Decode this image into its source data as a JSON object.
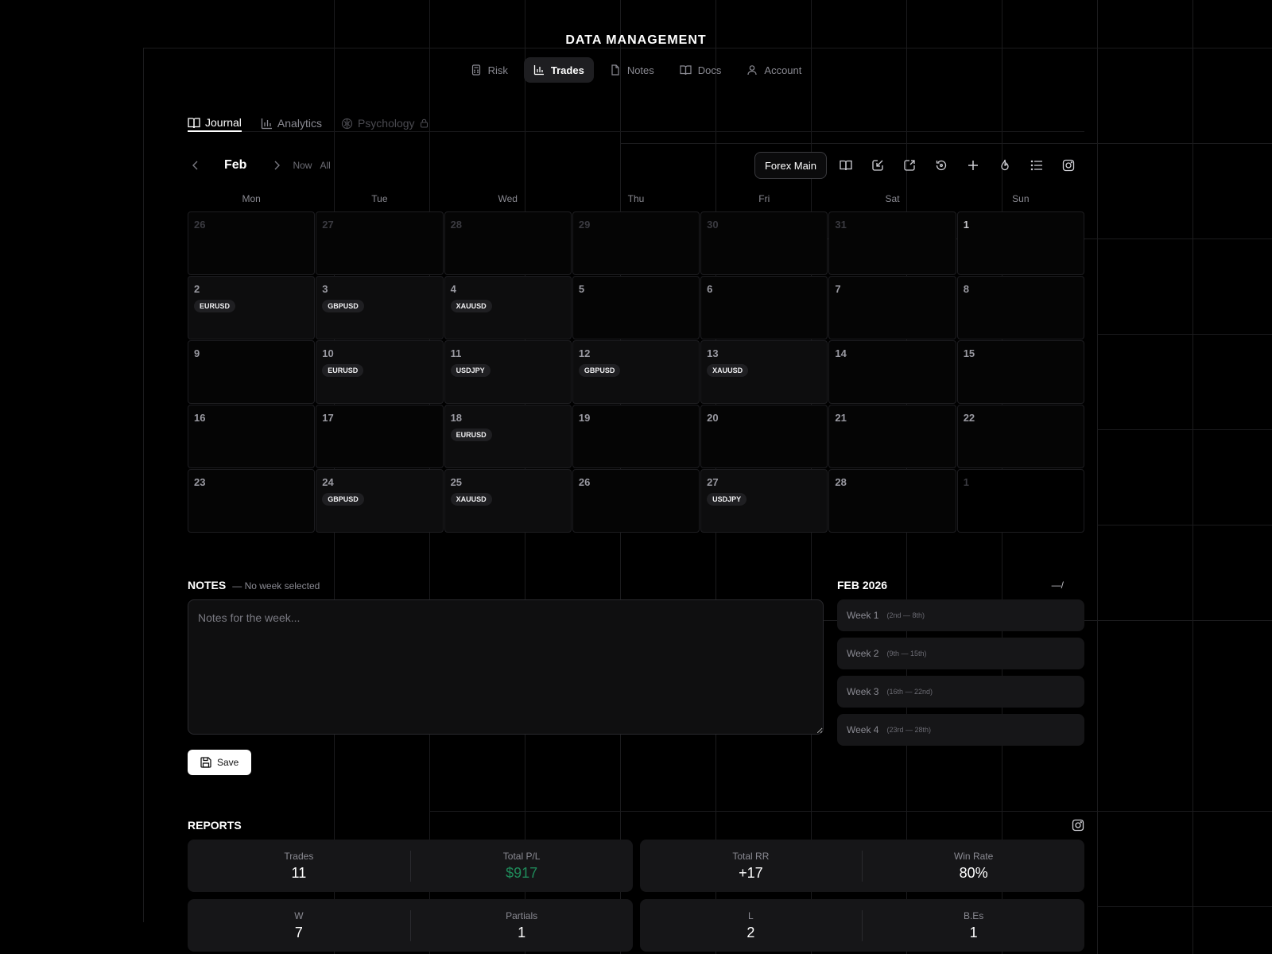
{
  "app_title": "DATA MANAGEMENT",
  "top_nav": [
    {
      "label": "Risk",
      "icon": "calculator-icon",
      "active": false
    },
    {
      "label": "Trades",
      "icon": "bar-chart-icon",
      "active": true
    },
    {
      "label": "Notes",
      "icon": "file-icon",
      "active": false
    },
    {
      "label": "Docs",
      "icon": "book-icon",
      "active": false
    },
    {
      "label": "Account",
      "icon": "user-icon",
      "active": false
    }
  ],
  "sub_tabs": [
    {
      "label": "Journal",
      "icon": "book-open-icon",
      "active": true
    },
    {
      "label": "Analytics",
      "icon": "bar-chart-icon",
      "active": false
    },
    {
      "label": "Psychology",
      "icon": "brain-icon",
      "locked": true
    }
  ],
  "calendar": {
    "month_label": "Feb",
    "now_label": "Now",
    "all_label": "All",
    "account_selector": "Forex Main",
    "weekdays": [
      "Mon",
      "Tue",
      "Wed",
      "Thu",
      "Fri",
      "Sat",
      "Sun"
    ],
    "days": [
      {
        "num": "26",
        "muted": true
      },
      {
        "num": "27",
        "muted": true
      },
      {
        "num": "28",
        "muted": true
      },
      {
        "num": "29",
        "muted": true
      },
      {
        "num": "30",
        "muted": true
      },
      {
        "num": "31",
        "muted": true
      },
      {
        "num": "1",
        "first": true
      },
      {
        "num": "2",
        "trade": "EURUSD"
      },
      {
        "num": "3",
        "trade": "GBPUSD"
      },
      {
        "num": "4",
        "trade": "XAUUSD"
      },
      {
        "num": "5"
      },
      {
        "num": "6"
      },
      {
        "num": "7"
      },
      {
        "num": "8"
      },
      {
        "num": "9"
      },
      {
        "num": "10",
        "trade": "EURUSD"
      },
      {
        "num": "11",
        "trade": "USDJPY"
      },
      {
        "num": "12",
        "trade": "GBPUSD"
      },
      {
        "num": "13",
        "trade": "XAUUSD"
      },
      {
        "num": "14"
      },
      {
        "num": "15"
      },
      {
        "num": "16"
      },
      {
        "num": "17"
      },
      {
        "num": "18",
        "trade": "EURUSD"
      },
      {
        "num": "19"
      },
      {
        "num": "20"
      },
      {
        "num": "21"
      },
      {
        "num": "22"
      },
      {
        "num": "23"
      },
      {
        "num": "24",
        "trade": "GBPUSD"
      },
      {
        "num": "25",
        "trade": "XAUUSD"
      },
      {
        "num": "26"
      },
      {
        "num": "27",
        "trade": "USDJPY"
      },
      {
        "num": "28"
      },
      {
        "num": "1",
        "muted": true,
        "empty": true
      }
    ]
  },
  "notes": {
    "title": "NOTES",
    "subtitle": "— No week selected",
    "placeholder": "Notes for the week...",
    "save_label": "Save"
  },
  "weeks": {
    "title": "FEB 2026",
    "right_label": "—/",
    "items": [
      {
        "label": "Week 1",
        "range": "(2nd — 8th)"
      },
      {
        "label": "Week 2",
        "range": "(9th — 15th)"
      },
      {
        "label": "Week 3",
        "range": "(16th — 22nd)"
      },
      {
        "label": "Week 4",
        "range": "(23rd — 28th)"
      }
    ]
  },
  "reports": {
    "title": "REPORTS",
    "cards": [
      [
        {
          "label": "Trades",
          "value": "11"
        },
        {
          "label": "Total P/L",
          "value": "$917",
          "positive": true
        }
      ],
      [
        {
          "label": "Total RR",
          "value": "+17"
        },
        {
          "label": "Win Rate",
          "value": "80%"
        }
      ],
      [
        {
          "label": "W",
          "value": "7"
        },
        {
          "label": "Partials",
          "value": "1"
        }
      ],
      [
        {
          "label": "L",
          "value": "2"
        },
        {
          "label": "B.Es",
          "value": "1"
        }
      ]
    ],
    "positive_color": "#1f8a5a"
  }
}
